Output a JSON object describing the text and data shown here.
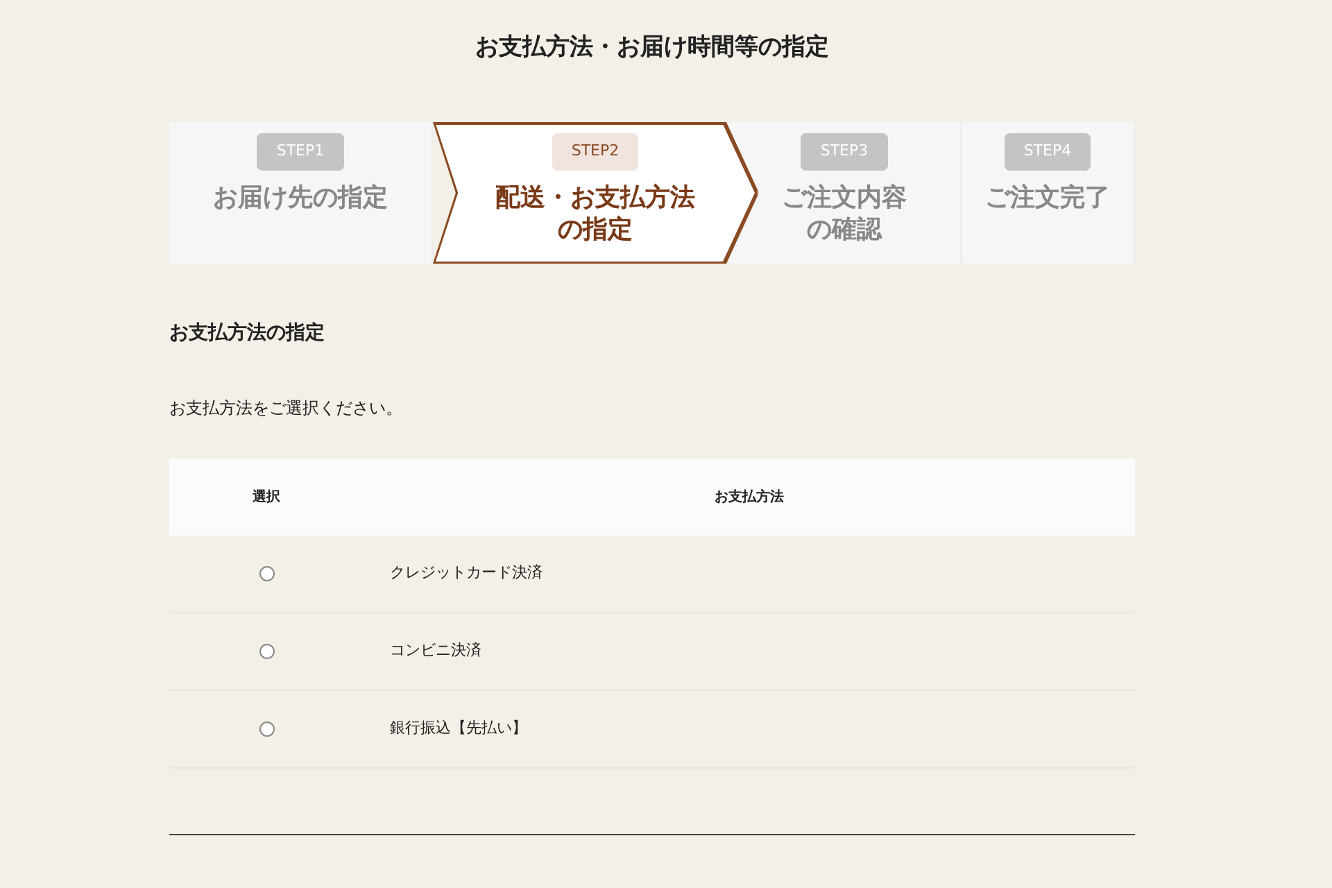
{
  "page_title": "お支払方法・お届け時間等の指定",
  "steps": [
    {
      "badge": "STEP1",
      "label": "お届け先の指定",
      "selected": false
    },
    {
      "badge": "STEP2",
      "label": "配送・お支払方法の指定",
      "selected": true
    },
    {
      "badge": "STEP3",
      "label": "ご注文内容の確認",
      "selected": false
    },
    {
      "badge": "STEP4",
      "label": "ご注文完了",
      "selected": false
    }
  ],
  "section": {
    "heading": "お支払方法の指定",
    "instruction": "お支払方法をご選択ください。"
  },
  "table": {
    "columns": [
      "選択",
      "お支払方法"
    ],
    "rows": [
      {
        "method": "クレジットカード決済",
        "selected": false
      },
      {
        "method": "コンビニ決済",
        "selected": false
      },
      {
        "method": "銀行振込【先払い】",
        "selected": false
      }
    ]
  }
}
